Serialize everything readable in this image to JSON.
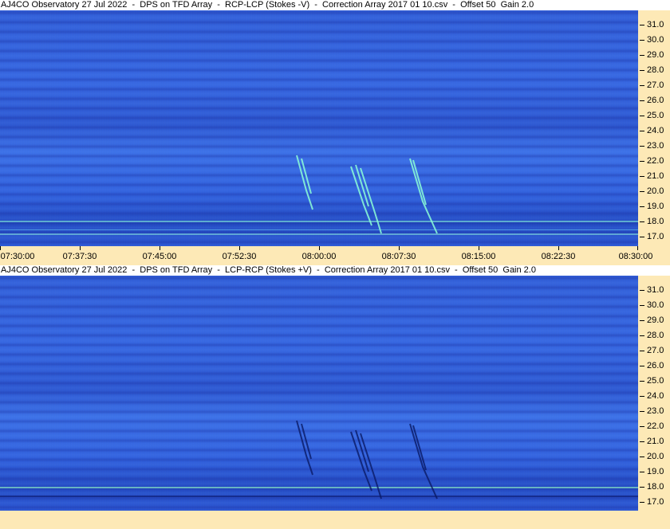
{
  "top_panel": {
    "title": "AJ4CO Observatory 27 Jul 2022  -  DPS on TFD Array  -  RCP-LCP (Stokes -V)  -  Correction Array 2017 01 10.csv  -  Offset 50  Gain 2.0",
    "y_ticks": [
      "31.0",
      "30.0",
      "29.0",
      "28.0",
      "27.0",
      "26.0",
      "25.0",
      "24.0",
      "23.0",
      "22.0",
      "21.0",
      "20.0",
      "19.0",
      "18.0",
      "17.0"
    ]
  },
  "time_axis": {
    "ticks": [
      "07:30:00",
      "07:37:30",
      "07:45:00",
      "07:52:30",
      "08:00:00",
      "08:07:30",
      "08:15:00",
      "08:22:30",
      "08:30:00"
    ]
  },
  "bottom_panel": {
    "title": "AJ4CO Observatory 27 Jul 2022  -  DPS on TFD Array  -  LCP-RCP (Stokes +V)  -  Correction Array 2017 01 10.csv  -  Offset 50  Gain 2.0",
    "y_ticks": [
      "31.0",
      "30.0",
      "29.0",
      "28.0",
      "27.0",
      "26.0",
      "25.0",
      "24.0",
      "23.0",
      "22.0",
      "21.0",
      "20.0",
      "19.0",
      "18.0",
      "17.0"
    ]
  },
  "colors": {
    "axis_background": "#fde9b6",
    "spectrogram_base": "#2f5fe0",
    "burst_top": "#7fffd4",
    "burst_bottom": "#0a1a66"
  }
}
